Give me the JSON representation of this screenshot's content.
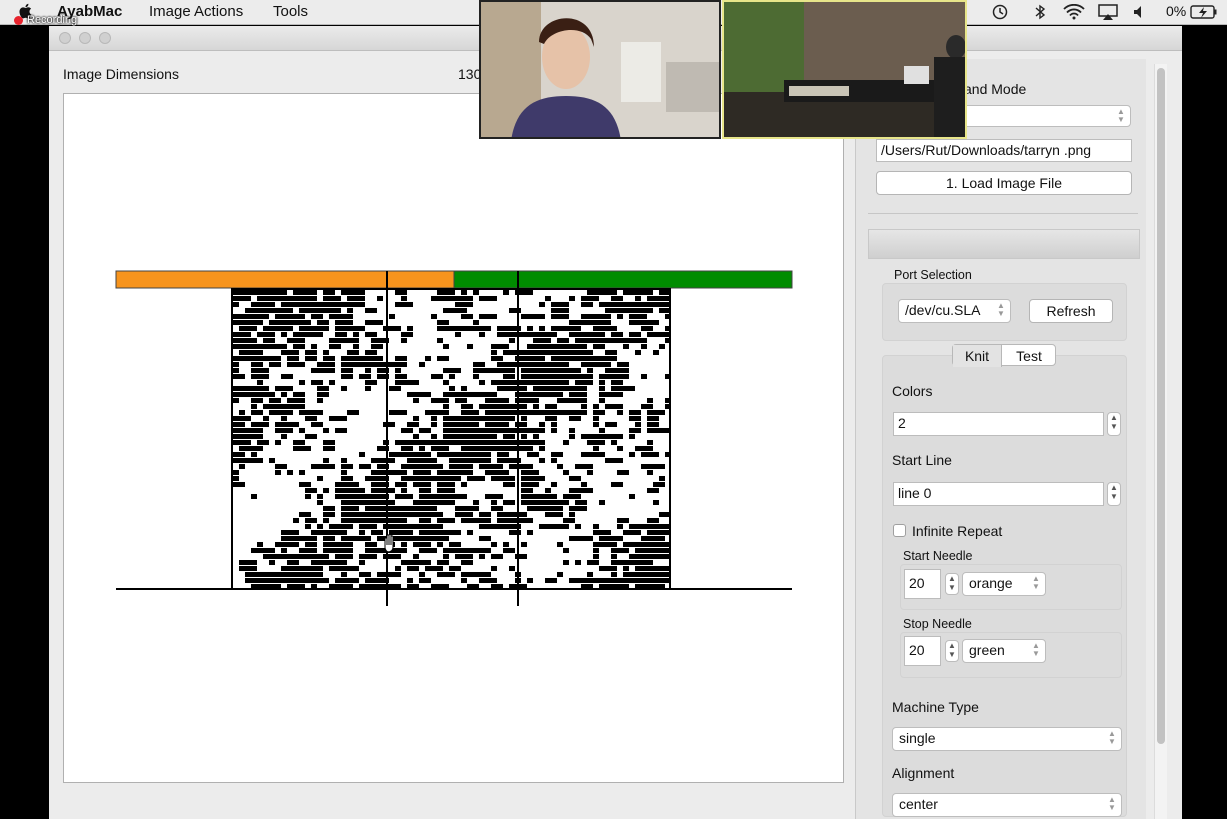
{
  "menubar": {
    "recording_label": "Recording",
    "app_name": "AyabMac",
    "menus": [
      "Image Actions",
      "Tools"
    ],
    "battery_label": "0%"
  },
  "window": {
    "image_dimensions_label": "Image Dimensions",
    "image_dimensions_value": "130"
  },
  "sidebar": {
    "mode_label_partial": "and Mode",
    "file_path": "/Users/Rut/Downloads/tarryn .png",
    "load_button": "1. Load Image File",
    "port_selection_label": "Port Selection",
    "port_value": "/dev/cu.SLA",
    "refresh_button": "Refresh",
    "tabs": [
      "Knit",
      "Test"
    ],
    "colors_label": "Colors",
    "colors_value": "2",
    "start_line_label": "Start Line",
    "start_line_value": "line 0",
    "infinite_repeat_label": "Infinite Repeat",
    "infinite_repeat_checked": false,
    "start_needle_label": "Start Needle",
    "start_needle_value": "20",
    "start_needle_color": "orange",
    "stop_needle_label": "Stop Needle",
    "stop_needle_value": "20",
    "stop_needle_color": "green",
    "machine_type_label": "Machine Type",
    "machine_type_value": "single",
    "alignment_label": "Alignment",
    "alignment_value": "center"
  },
  "needle_bar": {
    "left_color": "#f7941d",
    "right_color": "#008c00"
  }
}
